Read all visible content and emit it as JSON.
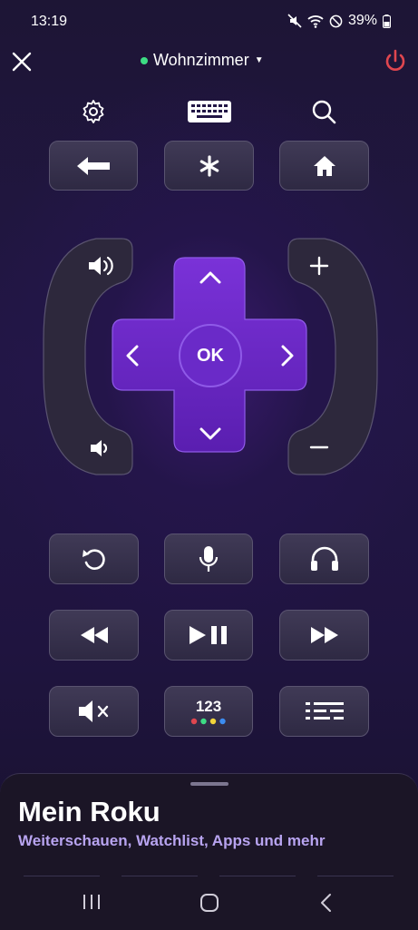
{
  "status_bar": {
    "time": "13:19",
    "battery": "39%"
  },
  "header": {
    "device_name": "Wohnzimmer",
    "device_status_color": "#3ddc84",
    "power_color": "#e0464f"
  },
  "colors": {
    "accent": "#6a2ac8",
    "subtitle": "#b8a4f0"
  },
  "toolbar": {
    "icons": [
      "settings-icon",
      "keyboard-icon",
      "search-icon"
    ]
  },
  "dpad": {
    "ok_label": "OK"
  },
  "numpad": {
    "label": "123"
  },
  "bottom_sheet": {
    "title": "Mein Roku",
    "subtitle": "Weiterschauen, Watchlist, Apps und mehr"
  }
}
